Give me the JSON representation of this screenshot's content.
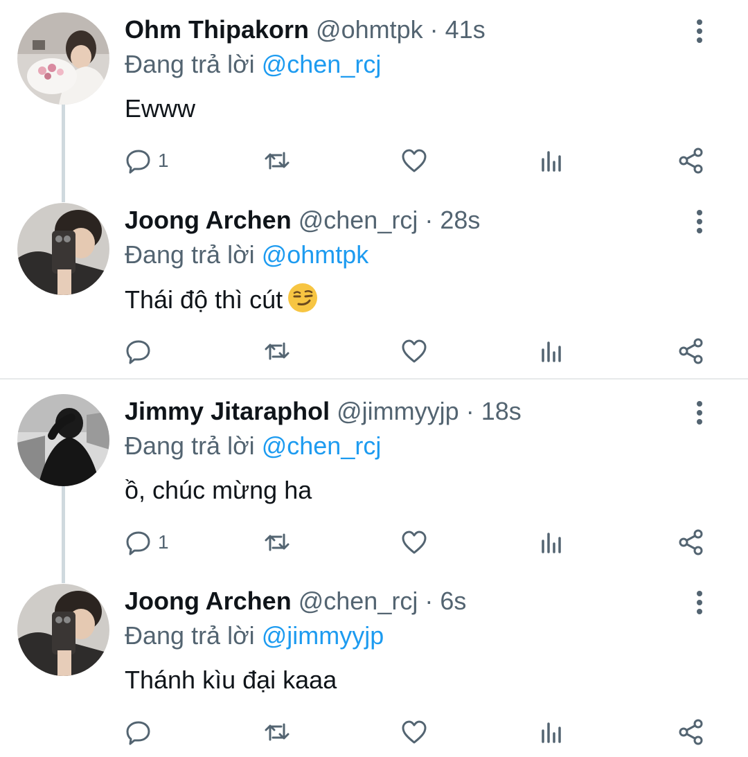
{
  "replying_prefix": "Đang trả lời",
  "tweets": [
    {
      "name": "Ohm Thipakorn",
      "handle": "@ohmtpk",
      "separator": "·",
      "time": "41s",
      "reply_to": "@chen_rcj",
      "text": "Ewww",
      "reply_count": "1",
      "avatar": "avatar-ohm"
    },
    {
      "name": "Joong Archen",
      "handle": "@chen_rcj",
      "separator": "·",
      "time": "28s",
      "reply_to": "@ohmtpk",
      "text": "Thái độ thì cút",
      "emoji": "smirking-face-emoji",
      "reply_count": "",
      "avatar": "avatar-joong"
    },
    {
      "name": "Jimmy Jitaraphol",
      "handle": "@jimmyyjp",
      "separator": "·",
      "time": "18s",
      "reply_to": "@chen_rcj",
      "text": "ồ, chúc mừng ha",
      "reply_count": "1",
      "avatar": "avatar-jimmy"
    },
    {
      "name": "Joong Archen",
      "handle": "@chen_rcj",
      "separator": "·",
      "time": "6s",
      "reply_to": "@jimmyyjp",
      "text": "Thánh kìu đại kaaa",
      "reply_count": "",
      "avatar": "avatar-joong"
    }
  ],
  "colors": {
    "mention": "#1d9bf0",
    "secondary": "#536471",
    "thread_line": "#cfd9de"
  },
  "icons": [
    "reply-icon",
    "retweet-icon",
    "like-icon",
    "analytics-icon",
    "share-icon",
    "more-icon"
  ]
}
